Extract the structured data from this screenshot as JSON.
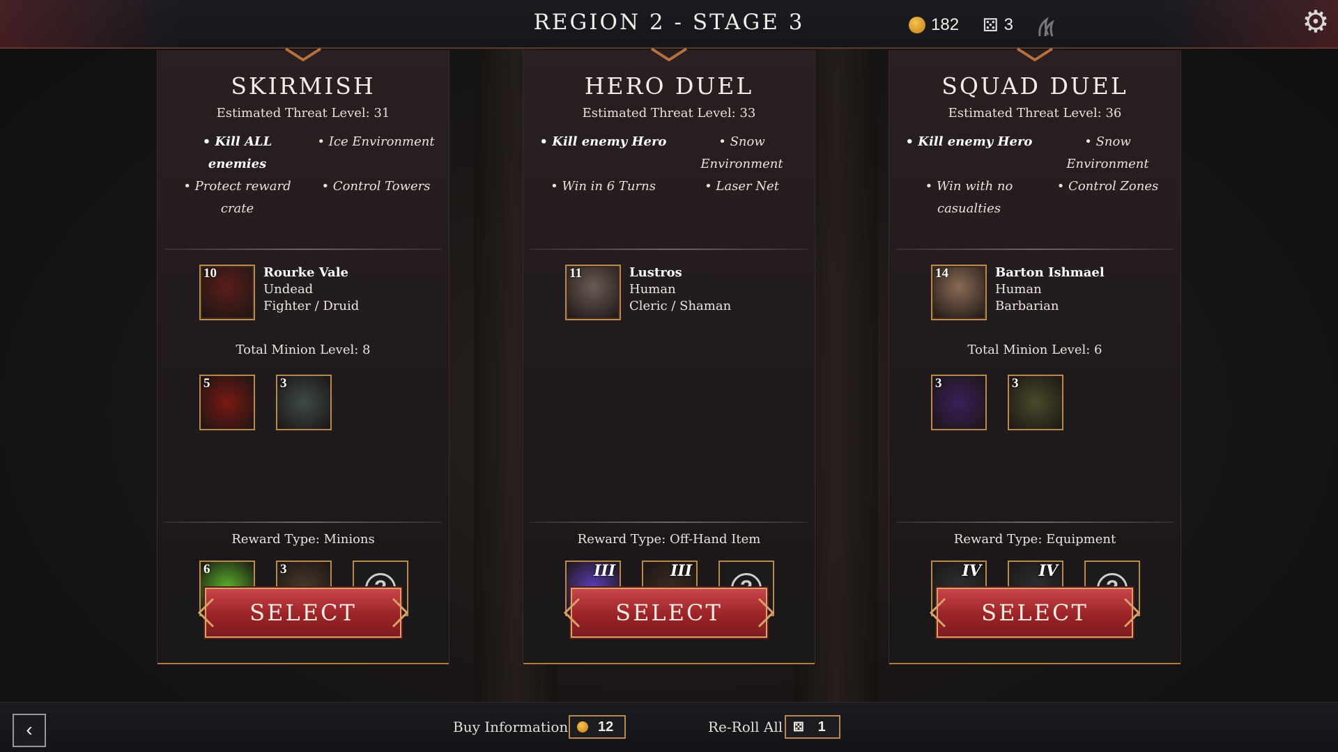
{
  "header": {
    "title": "REGION 2 - STAGE 3",
    "gold_value": "182",
    "reroll_value": "3",
    "icons": [
      "gold-coin-icon",
      "dice-icon",
      "claw-icon",
      "gear-icon"
    ]
  },
  "panels": [
    {
      "title": "SKIRMISH",
      "threat": "Estimated Threat Level: 31",
      "objectives": [
        {
          "text": "• Kill ALL enemies",
          "bold": true
        },
        {
          "text": "• Ice Environment",
          "bold": false
        },
        {
          "text": "• Protect reward crate",
          "bold": false
        },
        {
          "text": "• Control Towers",
          "bold": false
        }
      ],
      "hero": {
        "level": "10",
        "name": "Rourke Vale",
        "race": "Undead",
        "class": "Fighter / Druid"
      },
      "minion_level": "Total Minion Level: 8",
      "minions": [
        {
          "level": "5"
        },
        {
          "level": "3"
        }
      ],
      "reward_type": "Reward Type: Minions",
      "rewards": [
        {
          "label": "6"
        },
        {
          "label": "3"
        },
        {
          "label": "?"
        }
      ],
      "button": "SELECT"
    },
    {
      "title": "HERO DUEL",
      "threat": "Estimated Threat Level: 33",
      "objectives": [
        {
          "text": "• Kill enemy Hero",
          "bold": true
        },
        {
          "text": "• Snow Environment",
          "bold": false
        },
        {
          "text": "• Win in 6 Turns",
          "bold": false
        },
        {
          "text": "• Laser Net",
          "bold": false
        }
      ],
      "hero": {
        "level": "11",
        "name": "Lustros",
        "race": "Human",
        "class": "Cleric / Shaman"
      },
      "minion_level": "",
      "minions": [],
      "reward_type": "Reward Type: Off-Hand Item",
      "rewards": [
        {
          "label": "III"
        },
        {
          "label": "III"
        },
        {
          "label": "?"
        }
      ],
      "button": "SELECT"
    },
    {
      "title": "SQUAD DUEL",
      "threat": "Estimated Threat Level: 36",
      "objectives": [
        {
          "text": "• Kill enemy Hero",
          "bold": true
        },
        {
          "text": "• Snow Environment",
          "bold": false
        },
        {
          "text": "• Win with no casualties",
          "bold": false
        },
        {
          "text": "• Control Zones",
          "bold": false
        }
      ],
      "hero": {
        "level": "14",
        "name": "Barton Ishmael",
        "race": "Human",
        "class": "Barbarian"
      },
      "minion_level": "Total Minion Level: 6",
      "minions": [
        {
          "level": "3"
        },
        {
          "level": "3"
        }
      ],
      "reward_type": "Reward Type: Equipment",
      "rewards": [
        {
          "label": "IV"
        },
        {
          "label": "IV"
        },
        {
          "label": "?"
        }
      ],
      "button": "SELECT"
    }
  ],
  "footer": {
    "buy_info_label": "Buy Information",
    "buy_info_cost": "12",
    "reroll_label": "Re-Roll All",
    "reroll_cost": "1",
    "back_glyph": "‹"
  },
  "colors": {
    "accent_gold": "#b98a4d",
    "button_red": "#9a2327"
  }
}
